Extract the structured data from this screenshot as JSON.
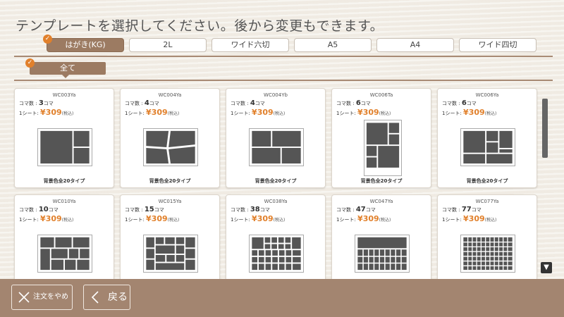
{
  "header": {
    "title": "テンプレートを選択してください。後から変更もできます。"
  },
  "size_tabs": [
    {
      "label": "はがき(KG)",
      "active": true
    },
    {
      "label": "2L",
      "active": false
    },
    {
      "label": "ワイド六切",
      "active": false
    },
    {
      "label": "A5",
      "active": false
    },
    {
      "label": "A4",
      "active": false
    },
    {
      "label": "ワイド四切",
      "active": false
    }
  ],
  "category_tabs": [
    {
      "label": "全て",
      "active": true
    }
  ],
  "labels": {
    "koma_label": "コマ数",
    "koma_unit": "コマ",
    "sheet_label": "1シート:",
    "tax": "(税込)"
  },
  "templates": [
    {
      "code": "WC003Ya",
      "koma": "3",
      "price": "¥309",
      "bg": "背景色全20タイプ"
    },
    {
      "code": "WC004Ya",
      "koma": "4",
      "price": "¥309",
      "bg": "背景色全20タイプ"
    },
    {
      "code": "WC004Yb",
      "koma": "4",
      "price": "¥309",
      "bg": "背景色全20タイプ"
    },
    {
      "code": "WC006Ta",
      "koma": "6",
      "price": "¥309",
      "bg": "背景色全20タイプ"
    },
    {
      "code": "WC006Ya",
      "koma": "6",
      "price": "¥309",
      "bg": "背景色全20タイプ"
    },
    {
      "code": "WC010Ya",
      "koma": "10",
      "price": "¥309",
      "bg": ""
    },
    {
      "code": "WC015Ya",
      "koma": "15",
      "price": "¥309",
      "bg": ""
    },
    {
      "code": "WC038Ya",
      "koma": "38",
      "price": "¥309",
      "bg": ""
    },
    {
      "code": "WC047Ya",
      "koma": "47",
      "price": "¥309",
      "bg": ""
    },
    {
      "code": "WC077Ya",
      "koma": "77",
      "price": "¥309",
      "bg": ""
    }
  ],
  "footer": {
    "cancel_label": "注文をやめる",
    "back_label": "戻る"
  },
  "colors": {
    "accent": "#e1802b",
    "brown": "#9c7b62",
    "footer": "#a38570"
  },
  "icons": {
    "check": "check-icon",
    "scroll_down": "triangle-down-icon",
    "cancel": "close-x-icon",
    "back": "chevron-left-icon"
  }
}
